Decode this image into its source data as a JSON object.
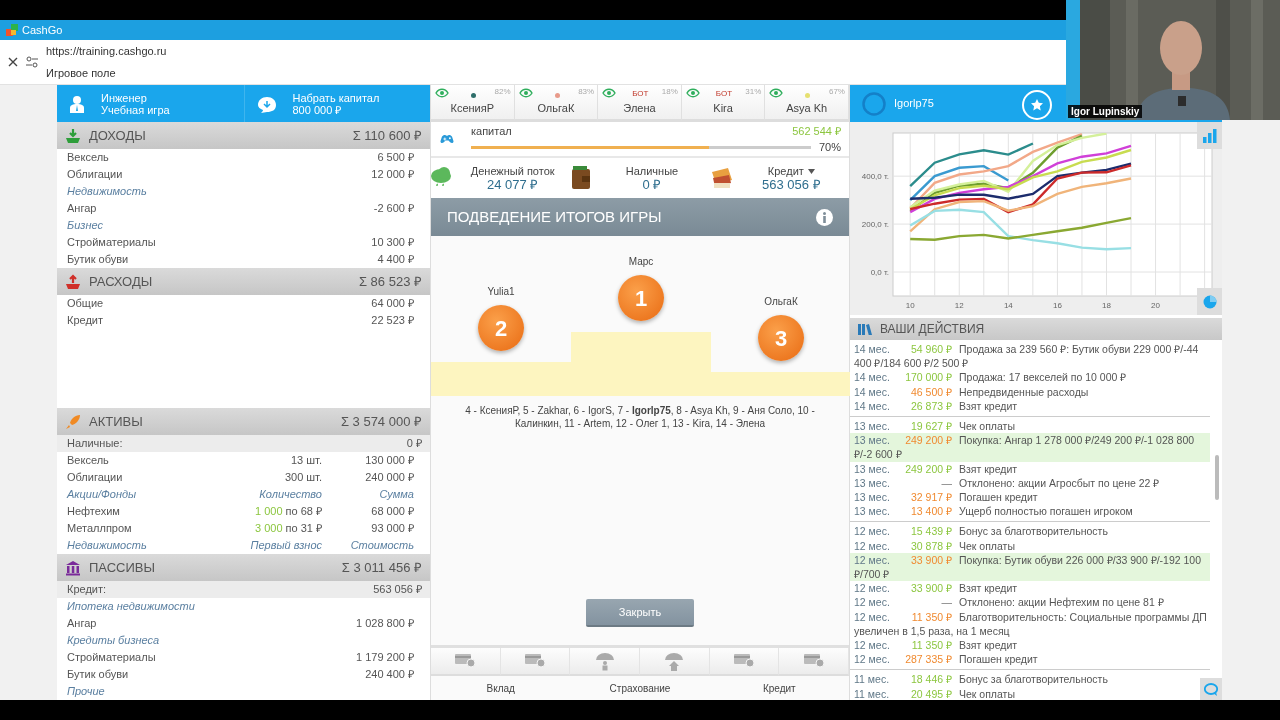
{
  "app_bar": {
    "title": "CashGo"
  },
  "address_bar": {
    "url": "https://training.cashgo.ru",
    "page_title": "Игровое поле"
  },
  "profile": {
    "role": "Инженер",
    "game_mode": "Учебная игра",
    "goal": "Набрать капитал",
    "goal_amount": "800 000 ₽"
  },
  "sections": [
    {
      "kind": "income",
      "title": "ДОХОДЫ",
      "total": "Σ 110 600 ₽",
      "rows": [
        {
          "kind": "item",
          "label": "Вексель",
          "value": "6 500 ₽"
        },
        {
          "kind": "item",
          "label": "Облигации",
          "value": "12 000 ₽"
        },
        {
          "kind": "category",
          "label": "Недвижимость"
        },
        {
          "kind": "item",
          "label": "Ангар",
          "value": "-2 600 ₽"
        },
        {
          "kind": "category",
          "label": "Бизнес"
        },
        {
          "kind": "item",
          "label": "Стройматериалы",
          "value": "10 300 ₽"
        },
        {
          "kind": "item",
          "label": "Бутик обуви",
          "value": "4 400 ₽"
        }
      ]
    },
    {
      "kind": "expense",
      "title": "РАСХОДЫ",
      "total": "Σ 86 523 ₽",
      "rows": [
        {
          "kind": "item",
          "label": "Общие",
          "value": "64 000 ₽"
        },
        {
          "kind": "item",
          "label": "Кредит",
          "value": "22 523 ₽"
        }
      ]
    },
    {
      "kind": "assets",
      "title": "АКТИВЫ",
      "total": "Σ 3 574 000 ₽",
      "summary": {
        "label": "Наличные:",
        "value": "0 ₽"
      },
      "rows": [
        {
          "kind": "item",
          "label": "Вексель",
          "middle": "13 шт.",
          "value": "130 000 ₽"
        },
        {
          "kind": "item",
          "label": "Облигации",
          "middle": "300 шт.",
          "value": "240 000 ₽"
        },
        {
          "kind": "category",
          "label": "Акции/Фонды",
          "middle": "Количество",
          "value": "Сумма"
        },
        {
          "kind": "item",
          "label": "Нефтехим",
          "quantity": "1 000",
          "middle": "по 68 ₽",
          "value": "68 000 ₽"
        },
        {
          "kind": "item",
          "label": "Металлпром",
          "quantity": "3 000",
          "middle": "по 31 ₽",
          "value": "93 000 ₽"
        },
        {
          "kind": "category",
          "label": "Недвижимость",
          "middle": "Первый взнос",
          "value": "Стоимость"
        }
      ]
    },
    {
      "kind": "liabilities",
      "title": "ПАССИВЫ",
      "total": "Σ 3 011 456 ₽",
      "summary": {
        "label": "Кредит:",
        "value": "563 056 ₽"
      },
      "rows": [
        {
          "kind": "category",
          "label": "Ипотека недвижимости"
        },
        {
          "kind": "item",
          "label": "Ангар",
          "value": "1 028 800 ₽"
        },
        {
          "kind": "category",
          "label": "Кредиты бизнеса"
        },
        {
          "kind": "item",
          "label": "Стройматериалы",
          "value": "1 179 200 ₽"
        },
        {
          "kind": "item",
          "label": "Бутик обуви",
          "value": "240 400 ₽"
        },
        {
          "kind": "category",
          "label": "Прочие"
        }
      ]
    }
  ],
  "players": [
    {
      "name": "КсенияР",
      "percent": "82%",
      "color": "#2e6e6a"
    },
    {
      "name": "ОльгаК",
      "percent": "83%",
      "color": "#e89a8a"
    },
    {
      "name": "Элена",
      "percent": "18%",
      "badge": "БОТ"
    },
    {
      "name": "Kira",
      "percent": "31%",
      "badge": "БОТ"
    },
    {
      "name": "Asya Kh",
      "percent": "67%",
      "color": "#e6e070"
    }
  ],
  "capital": {
    "label": "капитал",
    "value": "562 544 ₽",
    "level": 0.7,
    "percent": "70%"
  },
  "stats": [
    {
      "kind": "cashflow",
      "label": "Денежный поток",
      "value": "24 077 ₽"
    },
    {
      "kind": "cash",
      "label": "Наличные",
      "value": "0 ₽"
    },
    {
      "kind": "credit",
      "label": "Кредит",
      "value": "563 056 ₽",
      "dropdown": true
    }
  ],
  "results": {
    "title": "ПОДВЕДЕНИЕ ИТОГОВ ИГРЫ",
    "podium": [
      {
        "kind": "second",
        "place": "2",
        "name": "Yulia1"
      },
      {
        "kind": "first",
        "place": "1",
        "name": "Марс"
      },
      {
        "kind": "third",
        "place": "3",
        "name": "ОльгаК"
      }
    ],
    "others": "4 - КсенияР, 5 - Zakhar, 6 - IgorS, 7 - **Igorlp75**, 8 - Asya Kh, 9 - Аня Соло, 10 - Калинкин, 11 - Artem, 12 - Олег 1, 13 - Kira, 14 - Элена",
    "close_button": "Закрыть"
  },
  "toolbar": [
    {
      "label": "Вклад",
      "buttons": [
        {
          "kind": "card"
        },
        {
          "kind": "card"
        }
      ]
    },
    {
      "label": "Страхование",
      "buttons": [
        {
          "kind": "umbrella-person"
        },
        {
          "kind": "umbrella-house"
        }
      ]
    },
    {
      "label": "Кредит",
      "buttons": [
        {
          "kind": "card"
        },
        {
          "kind": "card"
        }
      ]
    }
  ],
  "activity": {
    "user": "Igorlp75",
    "chart_data": {
      "type": "line",
      "grid": true,
      "x": [
        10,
        11,
        12,
        13,
        14,
        15,
        16,
        17,
        18,
        19
      ],
      "xlim": [
        9.3,
        22.3
      ],
      "ylim": [
        -100,
        580
      ],
      "xticks": [
        10,
        12,
        14,
        16,
        18,
        20
      ],
      "yticks": [
        {
          "value": 0,
          "label": "0,0 т."
        },
        {
          "value": 200,
          "label": "200,0 т."
        },
        {
          "value": 400,
          "label": "400,0 т."
        }
      ],
      "series": [
        {
          "color": "#2b8c8c",
          "values": [
            358,
            456,
            491,
            508,
            490,
            536,
            null,
            null,
            null,
            null
          ]
        },
        {
          "color": "#3a9ad0",
          "values": [
            300,
            400,
            435,
            442,
            382,
            null,
            null,
            null,
            null,
            null
          ]
        },
        {
          "color": "#f2a888",
          "values": [
            265,
            372,
            407,
            420,
            442,
            501,
            540,
            575,
            null,
            null
          ]
        },
        {
          "color": "#6e9e2e",
          "values": [
            255,
            330,
            360,
            368,
            350,
            414,
            519,
            568,
            null,
            null
          ]
        },
        {
          "color": "#d4f09a",
          "values": [
            270,
            340,
            365,
            380,
            335,
            463,
            530,
            560,
            578,
            null
          ]
        },
        {
          "color": "#d040d8",
          "values": [
            250,
            305,
            330,
            345,
            355,
            400,
            453,
            481,
            495,
            526
          ]
        },
        {
          "color": "#c8dc50",
          "values": [
            262,
            320,
            350,
            360,
            345,
            395,
            420,
            460,
            478,
            509
          ]
        },
        {
          "color": "#1c2c6c",
          "values": [
            306,
            310,
            323,
            322,
            306,
            326,
            400,
            415,
            426,
            452
          ]
        },
        {
          "color": "#cc2a2a",
          "values": [
            262,
            285,
            302,
            305,
            250,
            282,
            390,
            415,
            416,
            445
          ]
        },
        {
          "color": "#f0b47a",
          "values": [
            170,
            262,
            292,
            296,
            256,
            275,
            326,
            355,
            370,
            390
          ]
        },
        {
          "color": "#98dfe4",
          "values": [
            194,
            255,
            260,
            250,
            150,
            133,
            120,
            102,
            95,
            100
          ]
        },
        {
          "color": "#8aa832",
          "values": [
            138,
            135,
            150,
            155,
            140,
            155,
            170,
            185,
            205,
            225
          ]
        }
      ]
    },
    "actions_title": "ВАШИ ДЕЙСТВИЯ",
    "groups": [
      {
        "entries": [
          {
            "month": "14 мес.",
            "amount": "54 960 ₽",
            "color": "#8cc63f",
            "text": "Продажа за 239 560 ₽: Бутик обуви 229 000 ₽/-44 400 ₽/184 600 ₽/2 500 ₽",
            "highlighted": false
          },
          {
            "month": "14 мес.",
            "amount": "170 000 ₽",
            "color": "#8cc63f",
            "text": "Продажа: 17 векселей по 10 000 ₽",
            "highlighted": false
          },
          {
            "month": "14 мес.",
            "amount": "46 500 ₽",
            "color": "#f08a30",
            "text": "Непредвиденные расходы",
            "highlighted": false
          },
          {
            "month": "14 мес.",
            "amount": "26 873 ₽",
            "color": "#8cc63f",
            "text": "Взят кредит",
            "highlighted": false
          }
        ]
      },
      {
        "entries": [
          {
            "month": "13 мес.",
            "amount": "19 627 ₽",
            "color": "#8cc63f",
            "text": "Чек оплаты",
            "highlighted": false
          },
          {
            "month": "13 мес.",
            "amount": "249 200 ₽",
            "color": "#f08a30",
            "text": "Покупка: Ангар 1 278 000 ₽/249 200 ₽/-1 028 800 ₽/-2 600 ₽",
            "highlighted": true
          },
          {
            "month": "13 мес.",
            "amount": "249 200 ₽",
            "color": "#8cc63f",
            "text": "Взят кредит",
            "highlighted": false
          },
          {
            "month": "13 мес.",
            "amount": "—",
            "text": "Отклонено: акции Агросбыт по цене 22 ₽",
            "highlighted": false
          },
          {
            "month": "13 мес.",
            "amount": "32 917 ₽",
            "color": "#f08a30",
            "text": "Погашен кредит",
            "highlighted": false
          },
          {
            "month": "13 мес.",
            "amount": "13 400 ₽",
            "color": "#f08a30",
            "text": "Ущерб полностью погашен игроком",
            "highlighted": false
          }
        ]
      },
      {
        "entries": [
          {
            "month": "12 мес.",
            "amount": "15 439 ₽",
            "color": "#8cc63f",
            "text": "Бонус за благотворительность",
            "highlighted": false
          },
          {
            "month": "12 мес.",
            "amount": "30 878 ₽",
            "color": "#8cc63f",
            "text": "Чек оплаты",
            "highlighted": false
          },
          {
            "month": "12 мес.",
            "amount": "33 900 ₽",
            "color": "#f08a30",
            "text": "Покупка: Бутик обуви 226 000 ₽/33 900 ₽/-192 100 ₽/700 ₽",
            "highlighted": true
          },
          {
            "month": "12 мес.",
            "amount": "33 900 ₽",
            "color": "#8cc63f",
            "text": "Взят кредит",
            "highlighted": false
          },
          {
            "month": "12 мес.",
            "amount": "—",
            "text": "Отклонено: акции Нефтехим по цене 81 ₽",
            "highlighted": false
          },
          {
            "month": "12 мес.",
            "amount": "11 350 ₽",
            "color": "#f08a30",
            "text": "Благотворительность: Социальные программы ДП увеличен в 1,5 раза, на 1 месяц",
            "highlighted": false
          },
          {
            "month": "12 мес.",
            "amount": "11 350 ₽",
            "color": "#8cc63f",
            "text": "Взят кредит",
            "highlighted": false
          },
          {
            "month": "12 мес.",
            "amount": "287 335 ₽",
            "color": "#f08a30",
            "text": "Погашен кредит",
            "highlighted": false
          }
        ]
      },
      {
        "entries": [
          {
            "month": "11 мес.",
            "amount": "18 446 ₽",
            "color": "#8cc63f",
            "text": "Бонус за благотворительность",
            "highlighted": false
          },
          {
            "month": "11 мес.",
            "amount": "20 495 ₽",
            "color": "#8cc63f",
            "text": "Чек оплаты",
            "highlighted": false
          }
        ]
      }
    ]
  },
  "video": {
    "kind": "picture",
    "caption": "Igor Lupinskiy"
  }
}
